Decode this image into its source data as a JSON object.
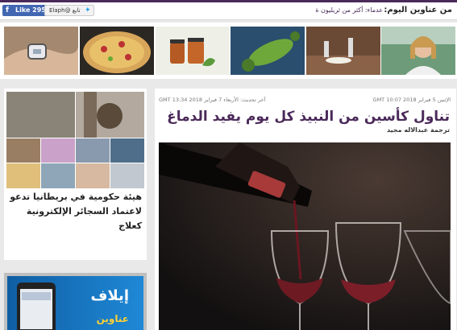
{
  "header": {
    "facebook": {
      "icon": "facebook-icon",
      "label": "Like 295k"
    },
    "twitter": {
      "icon": "twitter-icon",
      "label": "تابع @Elaph"
    },
    "headlines_label": "من عناوين اليوم:",
    "ticker_text": "عدماء: أكثر من ثريليون ة"
  },
  "thumbnails": [
    {
      "icon": "thumbnail-woman-portrait"
    },
    {
      "icon": "thumbnail-dinner-table"
    },
    {
      "icon": "thumbnail-virus"
    },
    {
      "icon": "thumbnail-jars"
    },
    {
      "icon": "thumbnail-pizza"
    },
    {
      "icon": "thumbnail-smartwatch"
    }
  ],
  "sidebar": {
    "story_title": "هيئة حكومية في بريطانيا تدعو لاعتماد السجائر الإلكترونية كعلاج"
  },
  "ad": {
    "title": "إيلاف",
    "subtitle": "عناوين"
  },
  "article": {
    "published": "الإثنين 5 فبراير 2018 10:07 GMT",
    "updated": "آخر تحديث: الأربعاء 7 فبراير 2018 13:34 GMT",
    "headline": "تناول كأسين من النبيذ كل يوم يفيد الدماغ",
    "byline": "ترجمة عبدالاله مجيد"
  },
  "colors": {
    "accent": "#4b2a5a",
    "facebook": "#4267b2",
    "twitter": "#1da1f2"
  }
}
